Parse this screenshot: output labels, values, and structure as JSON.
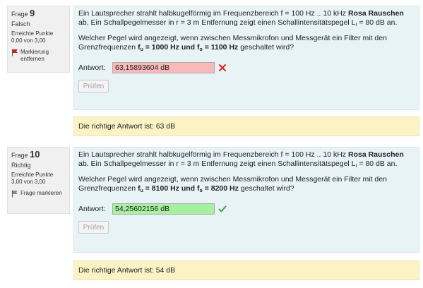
{
  "questions": [
    {
      "label": "Frage",
      "number": "9",
      "state": "Falsch",
      "grade_label": "Erreichte Punkte",
      "grade_value": "0,00 von 3,00",
      "flag_label": "Markierung entfernen",
      "text": {
        "p1_a": "Ein Lautsprecher strahlt halbkugelförmig im Frequenzbereich f = 100 Hz .. 10 kHz ",
        "p1_bold": "Rosa Rauschen",
        "p1_b": " ab. Ein Schallpegelmesser in r = 3 m Entfernung zeigt einen Schallintensitätspegel L",
        "p1_sub": "I",
        "p1_c": " = 80 dB an.",
        "p2_a": "Welcher Pegel wird angezeigt, wenn zwischen Messmikrofon und Messgerät ein Filter mit den Grenzfrequenzen ",
        "p2_fu": "f",
        "p2_fu_sub": "u",
        "p2_fu_val": " = 1000 Hz und ",
        "p2_fo": "f",
        "p2_fo_sub": "o",
        "p2_fo_val": " = 1100 Hz",
        "p2_b": " geschaltet wird?"
      },
      "answer_label": "Antwort:",
      "answer_value": "63,15893604 dB",
      "check_button": "Prüfen",
      "feedback": "Die richtige Antwort ist: 63 dB",
      "result": "incorrect"
    },
    {
      "label": "Frage",
      "number": "10",
      "state": "Richtig",
      "grade_label": "Erreichte Punkte",
      "grade_value": "3,00 von 3,00",
      "flag_label": "Frage markieren",
      "text": {
        "p1_a": "Ein Lautsprecher strahlt halbkugelförmig im Frequenzbereich f = 100 Hz .. 10 kHz ",
        "p1_bold": "Rosa Rauschen",
        "p1_b": " ab. Ein Schallpegelmesser in r = 3 m Entfernung zeigt einen Schallintensitätspegel L",
        "p1_sub": "I",
        "p1_c": " = 80 dB an.",
        "p2_a": "Welcher Pegel wird angezeigt, wenn zwischen Messmikrofon und Messgerät ein Filter mit den Grenzfrequenzen ",
        "p2_fu": "f",
        "p2_fu_sub": "u",
        "p2_fu_val": " = 8100 Hz und ",
        "p2_fo": "f",
        "p2_fo_sub": "o",
        "p2_fo_val": " = 8200 Hz",
        "p2_b": " geschaltet wird?"
      },
      "answer_label": "Antwort:",
      "answer_value": "54,25602156 dB",
      "check_button": "Prüfen",
      "feedback": "Die richtige Antwort ist: 54 dB",
      "result": "correct"
    }
  ],
  "colors": {
    "info_bg": "#f0f0f0",
    "formulation_bg": "#e7f3f5",
    "outcome_bg": "#fbf2c5",
    "wrong_input": "#f8b9b9",
    "right_input": "#a6f0a0",
    "cross_red": "#e02020",
    "check_green": "#3fa63f",
    "flag_red": "#cc2222"
  },
  "icons": {
    "flag_set": "red-flag-icon",
    "flag_unset": "grey-flag-icon",
    "incorrect": "red-cross-icon",
    "correct": "green-check-icon"
  }
}
